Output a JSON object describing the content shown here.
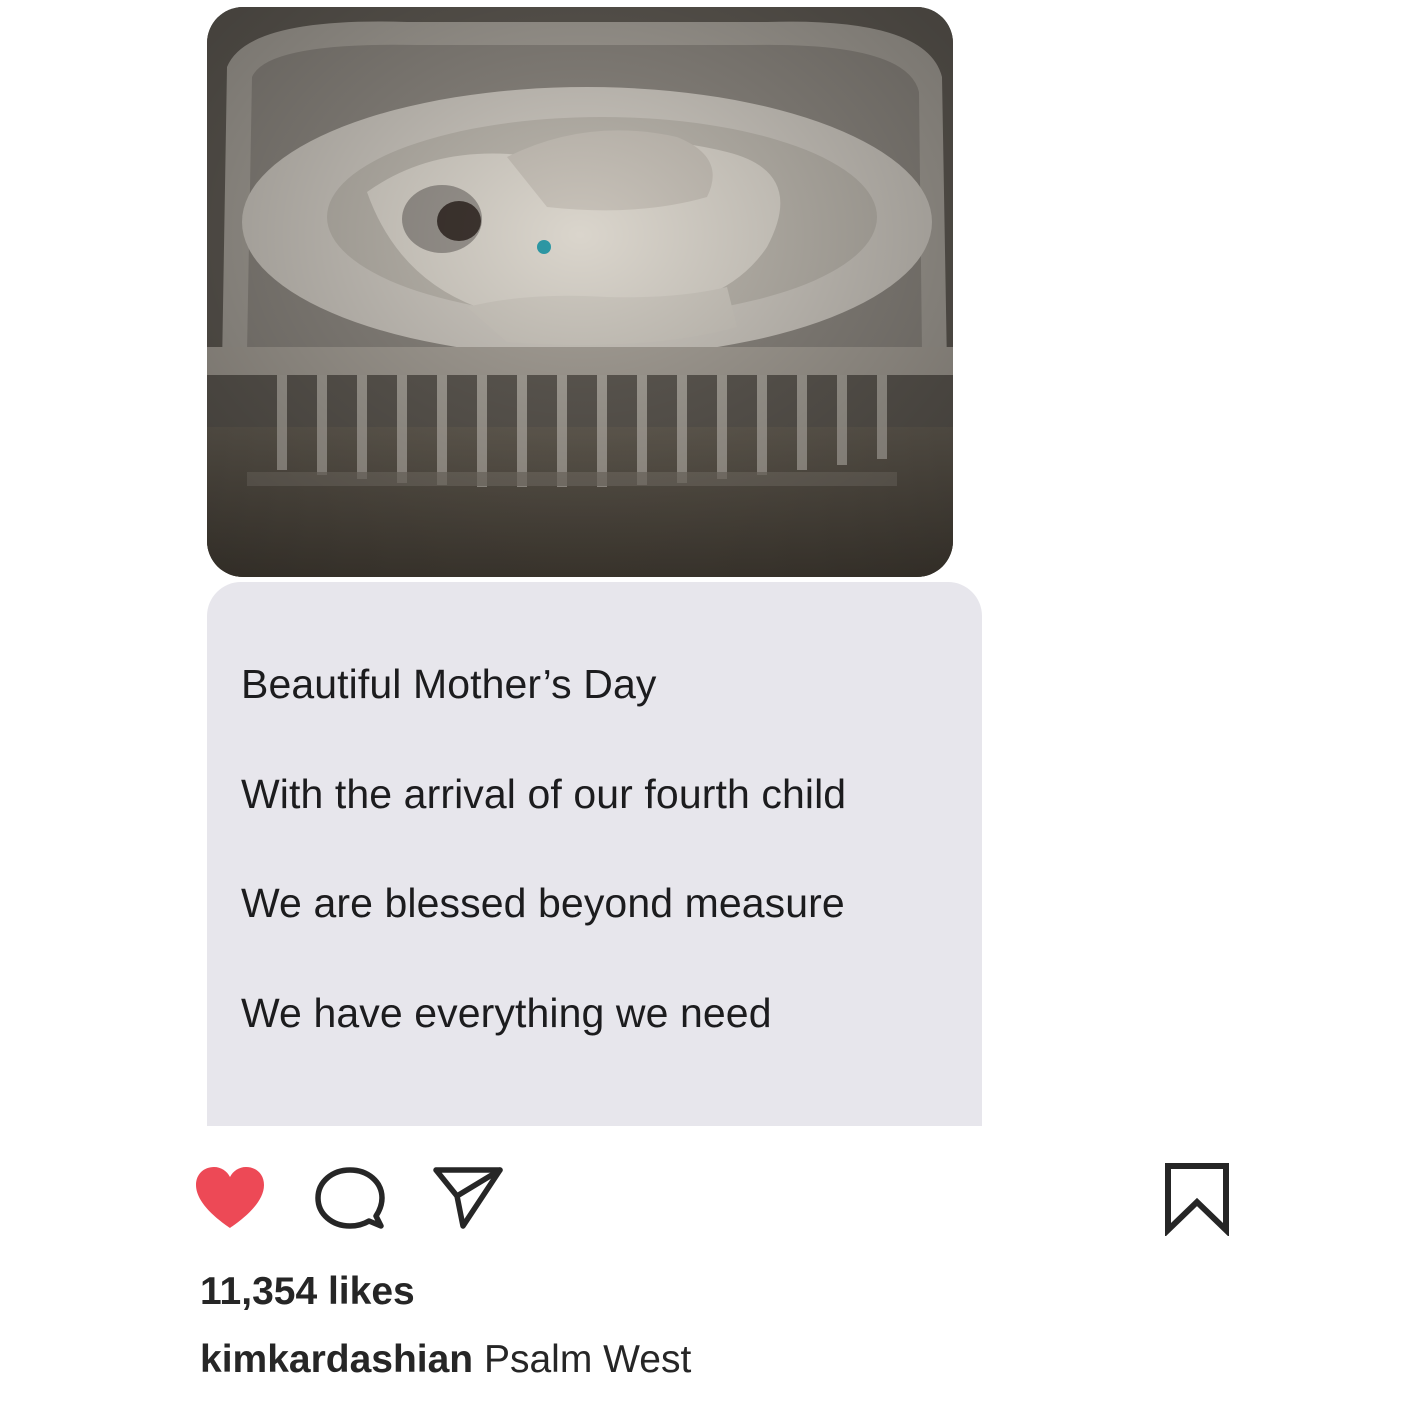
{
  "post": {
    "photo": {
      "subject": "newborn swaddled in a crib"
    },
    "message_lines": [
      "Beautiful Mother’s Day",
      "With the arrival of our fourth child",
      "We are blessed beyond measure",
      "We have everything we need"
    ],
    "actions": {
      "like_icon": "heart-icon",
      "like_liked": true,
      "like_color": "#ed4956",
      "comment_icon": "comment-icon",
      "share_icon": "paper-plane-icon",
      "save_icon": "bookmark-icon"
    },
    "likes_text": "11,354 likes",
    "caption": {
      "username": "kimkardashian",
      "text": "Psalm West"
    }
  },
  "colors": {
    "bubble_background": "#e7e6ec",
    "text": "#262626",
    "icon_stroke": "#262626"
  }
}
